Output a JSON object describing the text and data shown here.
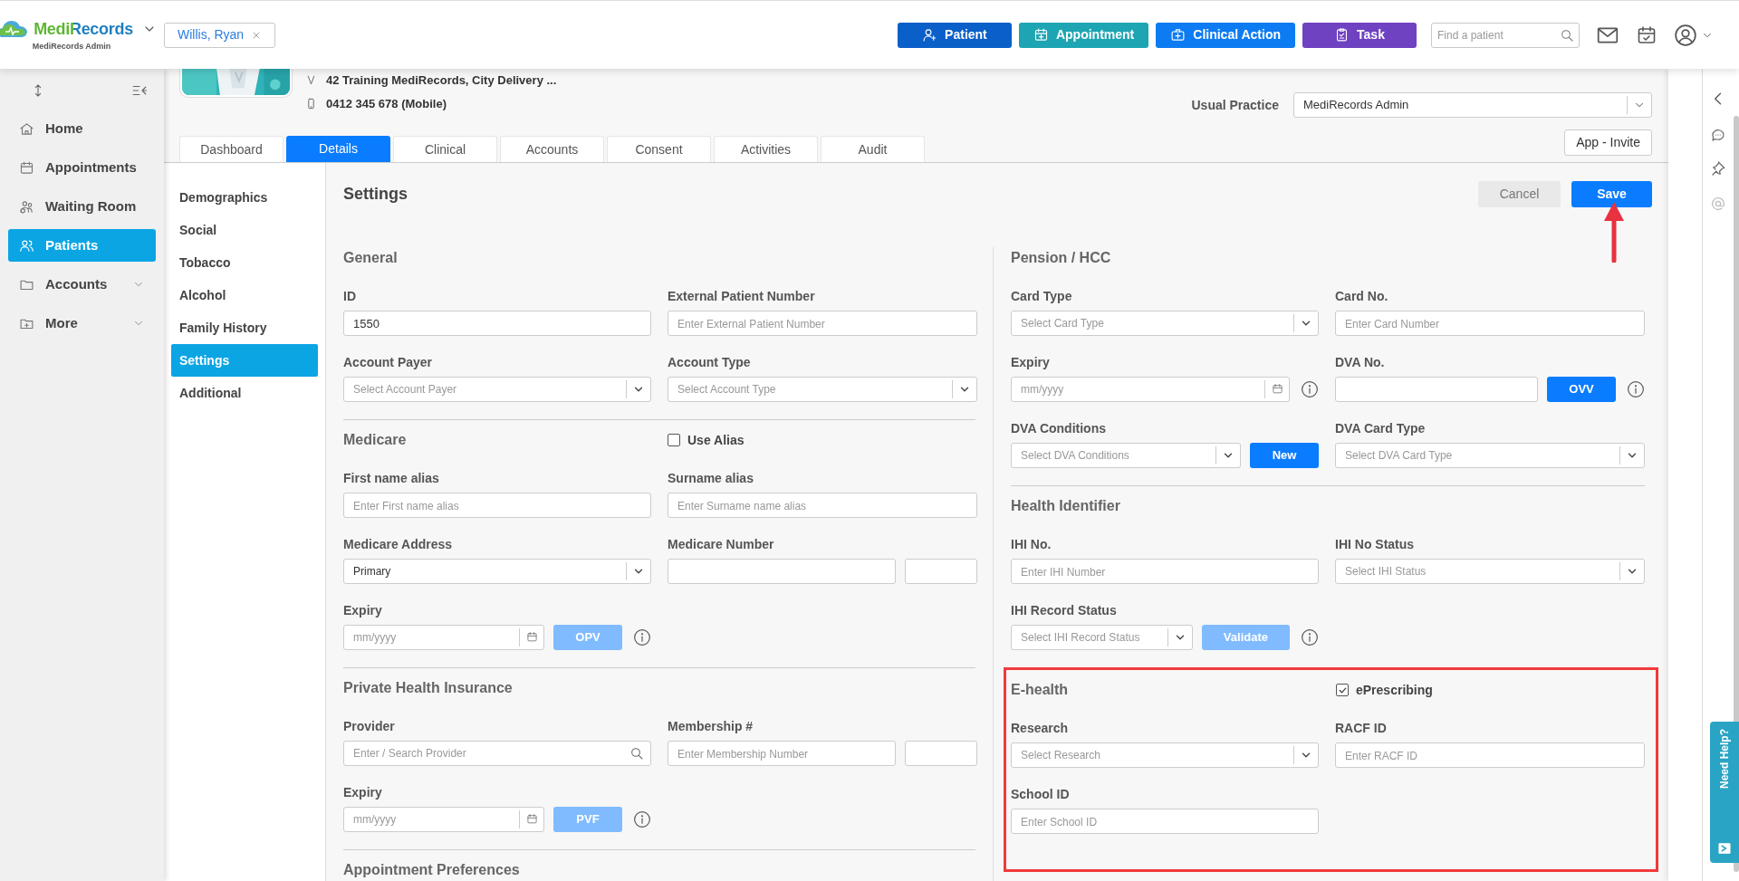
{
  "brand": {
    "name": "MediRecords",
    "subtitle": "MediRecords Admin"
  },
  "patient_tab": {
    "label": "Willis, Ryan"
  },
  "header_buttons": [
    {
      "label": "Patient",
      "kind": "patient",
      "color": "#0a5fc9"
    },
    {
      "label": "Appointment",
      "kind": "appointment",
      "color": "#1ea5b3"
    },
    {
      "label": "Clinical Action",
      "kind": "clinical",
      "color": "#0d7cf2"
    },
    {
      "label": "Task",
      "kind": "task",
      "color": "#6f42c1"
    }
  ],
  "search": {
    "placeholder": "Find a patient"
  },
  "sidebar": {
    "items": [
      {
        "label": "Home",
        "kind": "home",
        "selected": false,
        "expandable": false
      },
      {
        "label": "Appointments",
        "kind": "calendar",
        "selected": false,
        "expandable": false
      },
      {
        "label": "Waiting Room",
        "kind": "waiting",
        "selected": false,
        "expandable": false
      },
      {
        "label": "Patients",
        "kind": "patients",
        "selected": true,
        "expandable": false
      },
      {
        "label": "Accounts",
        "kind": "folder",
        "selected": false,
        "expandable": true
      },
      {
        "label": "More",
        "kind": "folder_plus",
        "selected": false,
        "expandable": true
      }
    ]
  },
  "patient": {
    "address": "42 Training MediRecords, City Delivery ...",
    "phone": "0412 345 678 (Mobile)",
    "usual_practice": {
      "label": "Usual Practice",
      "value": "MediRecords Admin"
    },
    "invite_button": "App - Invite"
  },
  "tabs": [
    {
      "label": "Dashboard",
      "selected": false
    },
    {
      "label": "Details",
      "selected": true
    },
    {
      "label": "Clinical",
      "selected": false
    },
    {
      "label": "Accounts",
      "selected": false
    },
    {
      "label": "Consent",
      "selected": false
    },
    {
      "label": "Activities",
      "selected": false
    },
    {
      "label": "Audit",
      "selected": false
    }
  ],
  "subnav": [
    {
      "label": "Demographics",
      "selected": false
    },
    {
      "label": "Social",
      "selected": false
    },
    {
      "label": "Tobacco",
      "selected": false
    },
    {
      "label": "Alcohol",
      "selected": false
    },
    {
      "label": "Family History",
      "selected": false
    },
    {
      "label": "Settings",
      "selected": true
    },
    {
      "label": "Additional",
      "selected": false
    }
  ],
  "settings": {
    "title": "Settings",
    "buttons": [
      {
        "label": "Cancel",
        "kind": "secondary"
      },
      {
        "label": "Save",
        "kind": "primary"
      }
    ],
    "columns": [
      {
        "sections": [
          {
            "heading": "General",
            "rows": [
              [
                {
                  "label": "ID",
                  "controls": [
                    {
                      "kind": "input",
                      "value": "1550"
                    }
                  ]
                },
                {
                  "label": "External Patient Number",
                  "controls": [
                    {
                      "kind": "input",
                      "placeholder": "Enter External Patient Number"
                    }
                  ]
                }
              ],
              [
                {
                  "label": "Account Payer",
                  "controls": [
                    {
                      "kind": "select",
                      "placeholder": "Select Account Payer"
                    }
                  ]
                },
                {
                  "label": "Account Type",
                  "controls": [
                    {
                      "kind": "select",
                      "placeholder": "Select Account Type"
                    }
                  ]
                }
              ]
            ]
          },
          {
            "heading": "Medicare",
            "toggle": {
              "label": "Use Alias",
              "checked": false
            },
            "rows": [
              [
                {
                  "label": "First name alias",
                  "controls": [
                    {
                      "kind": "input",
                      "placeholder": "Enter First name alias"
                    }
                  ]
                },
                {
                  "label": "Surname alias",
                  "controls": [
                    {
                      "kind": "input",
                      "placeholder": "Enter Surname name alias"
                    }
                  ]
                }
              ],
              [
                {
                  "label": "Medicare Address",
                  "controls": [
                    {
                      "kind": "select",
                      "value": "Primary"
                    }
                  ]
                },
                {
                  "label": "Medicare Number",
                  "controls": [
                    {
                      "kind": "input"
                    },
                    {
                      "kind": "short_input"
                    }
                  ]
                }
              ],
              [
                {
                  "label": "Expiry",
                  "controls": [
                    {
                      "kind": "date",
                      "placeholder": "mm/yyyy"
                    },
                    {
                      "kind": "button",
                      "label": "OPV",
                      "disabled": true
                    },
                    {
                      "kind": "info"
                    }
                  ]
                }
              ]
            ]
          },
          {
            "heading": "Private Health Insurance",
            "rows": [
              [
                {
                  "label": "Provider",
                  "controls": [
                    {
                      "kind": "search",
                      "placeholder": "Enter / Search Provider"
                    }
                  ]
                },
                {
                  "label": "Membership #",
                  "controls": [
                    {
                      "kind": "input",
                      "placeholder": "Enter Membership Number"
                    },
                    {
                      "kind": "short_input"
                    }
                  ]
                }
              ],
              [
                {
                  "label": "Expiry",
                  "controls": [
                    {
                      "kind": "date",
                      "placeholder": "mm/yyyy"
                    },
                    {
                      "kind": "button",
                      "label": "PVF",
                      "disabled": true
                    },
                    {
                      "kind": "info"
                    }
                  ]
                }
              ]
            ]
          },
          {
            "heading": "Appointment Preferences"
          }
        ]
      },
      {
        "sections": [
          {
            "heading": "Pension / HCC",
            "rows": [
              [
                {
                  "label": "Card Type",
                  "controls": [
                    {
                      "kind": "select",
                      "placeholder": "Select Card Type"
                    }
                  ]
                },
                {
                  "label": "Card No.",
                  "controls": [
                    {
                      "kind": "input",
                      "placeholder": "Enter Card Number"
                    }
                  ]
                }
              ],
              [
                {
                  "label": "Expiry",
                  "controls": [
                    {
                      "kind": "date",
                      "placeholder": "mm/yyyy"
                    },
                    {
                      "kind": "info"
                    }
                  ]
                },
                {
                  "label": "DVA No.",
                  "controls": [
                    {
                      "kind": "input"
                    },
                    {
                      "kind": "button",
                      "label": "OVV",
                      "disabled": false
                    },
                    {
                      "kind": "info"
                    }
                  ]
                }
              ],
              [
                {
                  "label": "DVA Conditions",
                  "controls": [
                    {
                      "kind": "select",
                      "placeholder": "Select DVA Conditions"
                    },
                    {
                      "kind": "button",
                      "label": "New",
                      "disabled": false
                    }
                  ]
                },
                {
                  "label": "DVA Card Type",
                  "controls": [
                    {
                      "kind": "select",
                      "placeholder": "Select DVA Card Type"
                    }
                  ]
                }
              ]
            ]
          },
          {
            "heading": "Health Identifier",
            "rows": [
              [
                {
                  "label": "IHI No.",
                  "controls": [
                    {
                      "kind": "input",
                      "placeholder": "Enter IHI Number"
                    }
                  ]
                },
                {
                  "label": "IHI No Status",
                  "controls": [
                    {
                      "kind": "select",
                      "placeholder": "Select IHI Status"
                    }
                  ]
                }
              ],
              [
                {
                  "label": "IHI Record Status",
                  "controls": [
                    {
                      "kind": "select",
                      "placeholder": "Select IHI Record Status"
                    },
                    {
                      "kind": "button",
                      "label": "Validate",
                      "disabled": true
                    },
                    {
                      "kind": "info"
                    }
                  ]
                }
              ]
            ]
          },
          {
            "heading": "E-health",
            "highlighted": true,
            "toggle": {
              "label": "ePrescribing",
              "checked": true
            },
            "rows": [
              [
                {
                  "label": "Research",
                  "controls": [
                    {
                      "kind": "select",
                      "placeholder": "Select Research"
                    }
                  ]
                },
                {
                  "label": "RACF ID",
                  "controls": [
                    {
                      "kind": "input",
                      "placeholder": "Enter RACF ID"
                    }
                  ]
                }
              ],
              [
                {
                  "label": "School ID",
                  "controls": [
                    {
                      "kind": "input",
                      "placeholder": "Enter School ID"
                    }
                  ]
                }
              ]
            ]
          }
        ]
      }
    ]
  },
  "help_tab": {
    "label": "Need Help?"
  }
}
